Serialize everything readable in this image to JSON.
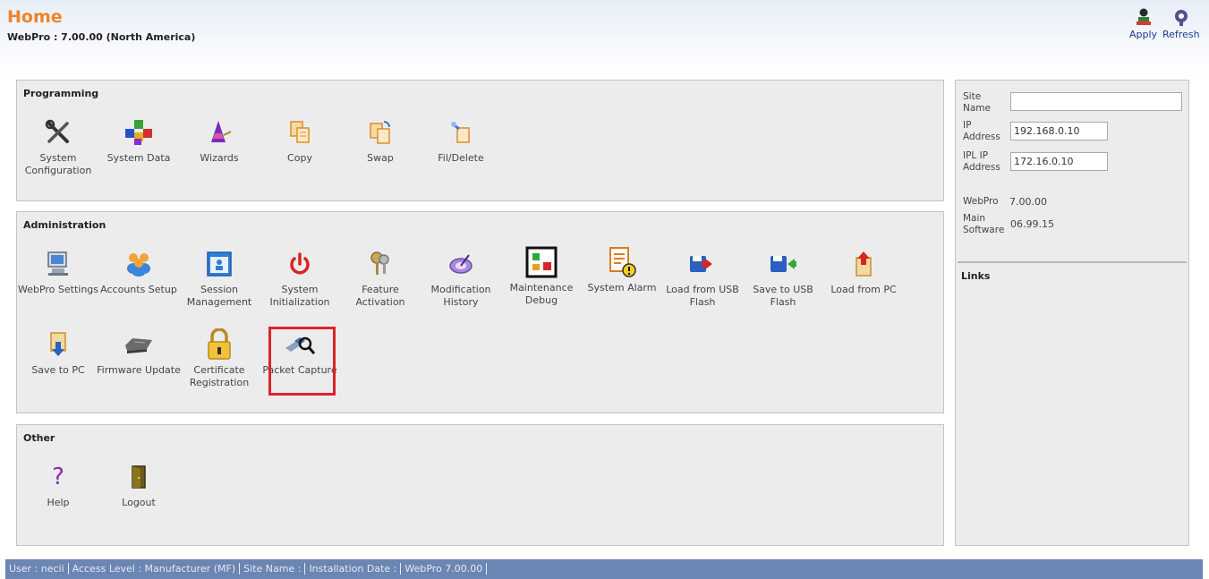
{
  "header": {
    "title": "Home",
    "subtitle": "WebPro : 7.00.00 (North America)",
    "apply_label": "Apply",
    "refresh_label": "Refresh"
  },
  "programming": {
    "title": "Programming",
    "items": [
      {
        "label": "System Configuration",
        "icon": "tools-icon"
      },
      {
        "label": "System Data",
        "icon": "colored-cubes-icon"
      },
      {
        "label": "Wizards",
        "icon": "wizard-hat-icon"
      },
      {
        "label": "Copy",
        "icon": "copy-icon"
      },
      {
        "label": "Swap",
        "icon": "swap-icon"
      },
      {
        "label": "Fil/Delete",
        "icon": "fill-delete-icon"
      }
    ]
  },
  "administration": {
    "title": "Administration",
    "items": [
      {
        "label": "WebPro Settings",
        "icon": "computer-icon"
      },
      {
        "label": "Accounts Setup",
        "icon": "users-icon"
      },
      {
        "label": "Session Management",
        "icon": "session-window-icon"
      },
      {
        "label": "System Initialization",
        "icon": "power-icon"
      },
      {
        "label": "Feature Activation",
        "icon": "keys-icon"
      },
      {
        "label": "Modification History",
        "icon": "history-icon"
      },
      {
        "label": "Maintenance Debug",
        "icon": "debug-icon"
      },
      {
        "label": "System Alarm",
        "icon": "alarm-icon"
      },
      {
        "label": "Load from USB Flash",
        "icon": "load-usb-icon"
      },
      {
        "label": "Save to USB Flash",
        "icon": "save-usb-icon"
      },
      {
        "label": "Load from PC",
        "icon": "load-pc-icon"
      },
      {
        "label": "Save to PC",
        "icon": "save-pc-icon"
      },
      {
        "label": "Firmware Update",
        "icon": "firmware-icon"
      },
      {
        "label": "Certificate Registration",
        "icon": "padlock-icon"
      },
      {
        "label": "Packet Capture",
        "icon": "packet-capture-icon"
      }
    ]
  },
  "other": {
    "title": "Other",
    "items": [
      {
        "label": "Help",
        "icon": "help-icon"
      },
      {
        "label": "Logout",
        "icon": "door-icon"
      }
    ]
  },
  "side": {
    "site_name_label": "Site Name",
    "site_name_value": "",
    "ip_label": "IP Address",
    "ip_value": "192.168.0.10",
    "ipl_ip_label": "IPL IP Address",
    "ipl_ip_value": "172.16.0.10",
    "webpro_label": "WebPro",
    "webpro_value": "7.00.00",
    "main_software_label": "Main Software",
    "main_software_value": "06.99.15",
    "links_title": "Links"
  },
  "status_bar": {
    "user": "User : necii",
    "access": "Access Level : Manufacturer (MF)",
    "site": "Site Name :",
    "install": "Installation Date :",
    "version": "WebPro 7.00.00"
  },
  "colors": {
    "title": "#f0822a",
    "status_bar": "#6b86b3",
    "highlight": "#d9242b"
  }
}
